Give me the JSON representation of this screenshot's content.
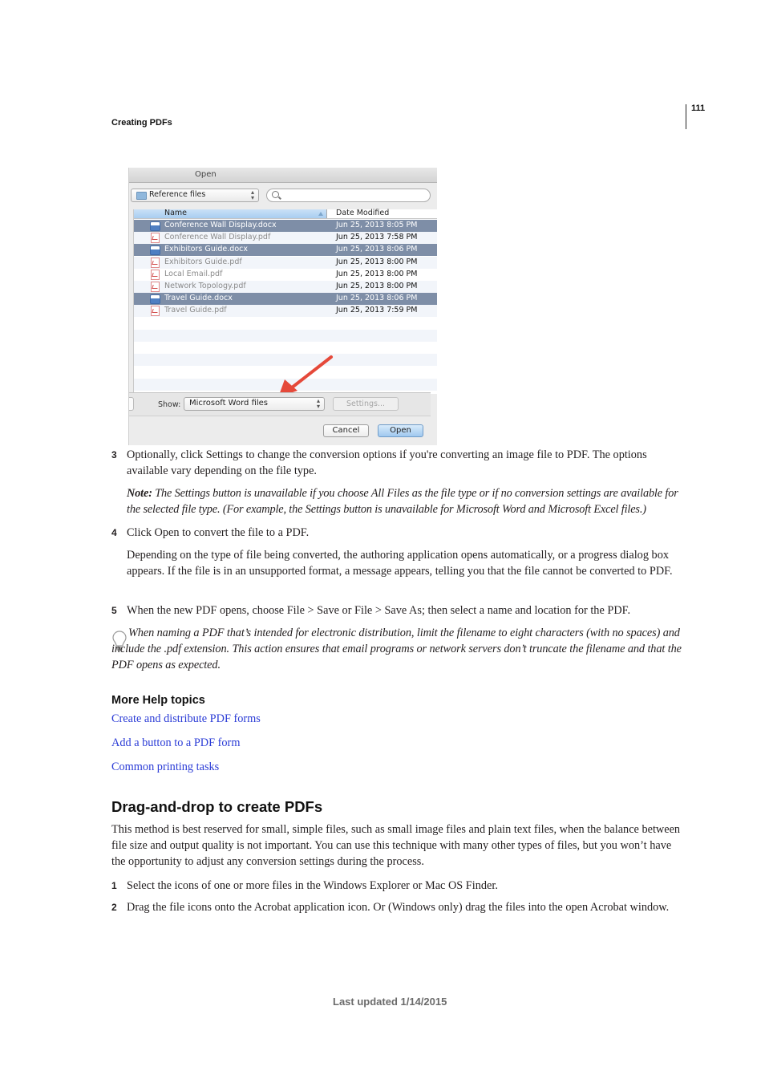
{
  "header": {
    "running_head": "Creating PDFs",
    "page_number": "111"
  },
  "dialog": {
    "title": "Open",
    "location": "Reference files",
    "search_placeholder": "",
    "columns": {
      "name": "Name",
      "date": "Date Modified"
    },
    "files": [
      {
        "name": "Conference Wall Display.docx",
        "date": "Jun 25, 2013 8:05 PM",
        "type": "docx",
        "selected": true
      },
      {
        "name": "Conference Wall Display.pdf",
        "date": "Jun 25, 2013 7:58 PM",
        "type": "pdf",
        "selected": false
      },
      {
        "name": "Exhibitors Guide.docx",
        "date": "Jun 25, 2013 8:06 PM",
        "type": "docx",
        "selected": true
      },
      {
        "name": "Exhibitors Guide.pdf",
        "date": "Jun 25, 2013 8:00 PM",
        "type": "pdf",
        "selected": false
      },
      {
        "name": "Local Email.pdf",
        "date": "Jun 25, 2013 8:00 PM",
        "type": "pdf",
        "selected": false
      },
      {
        "name": "Network Topology.pdf",
        "date": "Jun 25, 2013 8:00 PM",
        "type": "pdf",
        "selected": false
      },
      {
        "name": "Travel Guide.docx",
        "date": "Jun 25, 2013 8:06 PM",
        "type": "docx",
        "selected": true
      },
      {
        "name": "Travel Guide.pdf",
        "date": "Jun 25, 2013 7:59 PM",
        "type": "pdf",
        "selected": false
      }
    ],
    "show_label": "Show:",
    "show_value": "Microsoft Word files",
    "settings_label": "Settings...",
    "cancel_label": "Cancel",
    "open_label": "Open",
    "arrow_color": "#e5493a"
  },
  "steps_a": [
    {
      "num": "3",
      "text": "Optionally, click Settings to change the conversion options if you're converting an image file to PDF. The options available vary depending on the file type."
    },
    {
      "num": "4",
      "text": "Click Open to convert the file to a PDF."
    },
    {
      "num": "5",
      "text": "When the new PDF opens, choose File > Save or File > Save As; then select a name and location for the PDF."
    }
  ],
  "note": {
    "label": "Note:",
    "text": " The Settings button is unavailable if you choose All Files as the file type or if no conversion settings are available for the selected file type. (For example, the Settings button is unavailable for Microsoft Word and Microsoft Excel files.)"
  },
  "step4_detail": "Depending on the type of file being converted, the authoring application opens automatically, or a progress dialog box appears. If the file is in an unsupported format, a message appears, telling you that the file cannot be converted to PDF.",
  "tip": "When naming a PDF that’s intended for electronic distribution, limit the filename to eight characters (with no spaces) and include the .pdf extension. This action ensures that email programs or network servers don’t truncate the filename and that the PDF opens as expected.",
  "more_help": {
    "heading": "More Help topics",
    "links": [
      "Create and distribute PDF forms",
      "Add a button to a PDF form",
      "Common printing tasks"
    ],
    "link_color": "#2a3bd6"
  },
  "section": {
    "heading": "Drag-and-drop to create PDFs",
    "intro": "This method is best reserved for small, simple files, such as small image files and plain text files, when the balance between file size and output quality is not important. You can use this technique with many other types of files, but you won’t have the opportunity to adjust any conversion settings during the process.",
    "steps": [
      {
        "num": "1",
        "text": "Select the icons of one or more files in the Windows Explorer or Mac OS Finder."
      },
      {
        "num": "2",
        "text": "Drag the file icons onto the Acrobat application icon. Or (Windows only) drag the files into the open Acrobat window."
      }
    ]
  },
  "footer": "Last updated 1/14/2015"
}
